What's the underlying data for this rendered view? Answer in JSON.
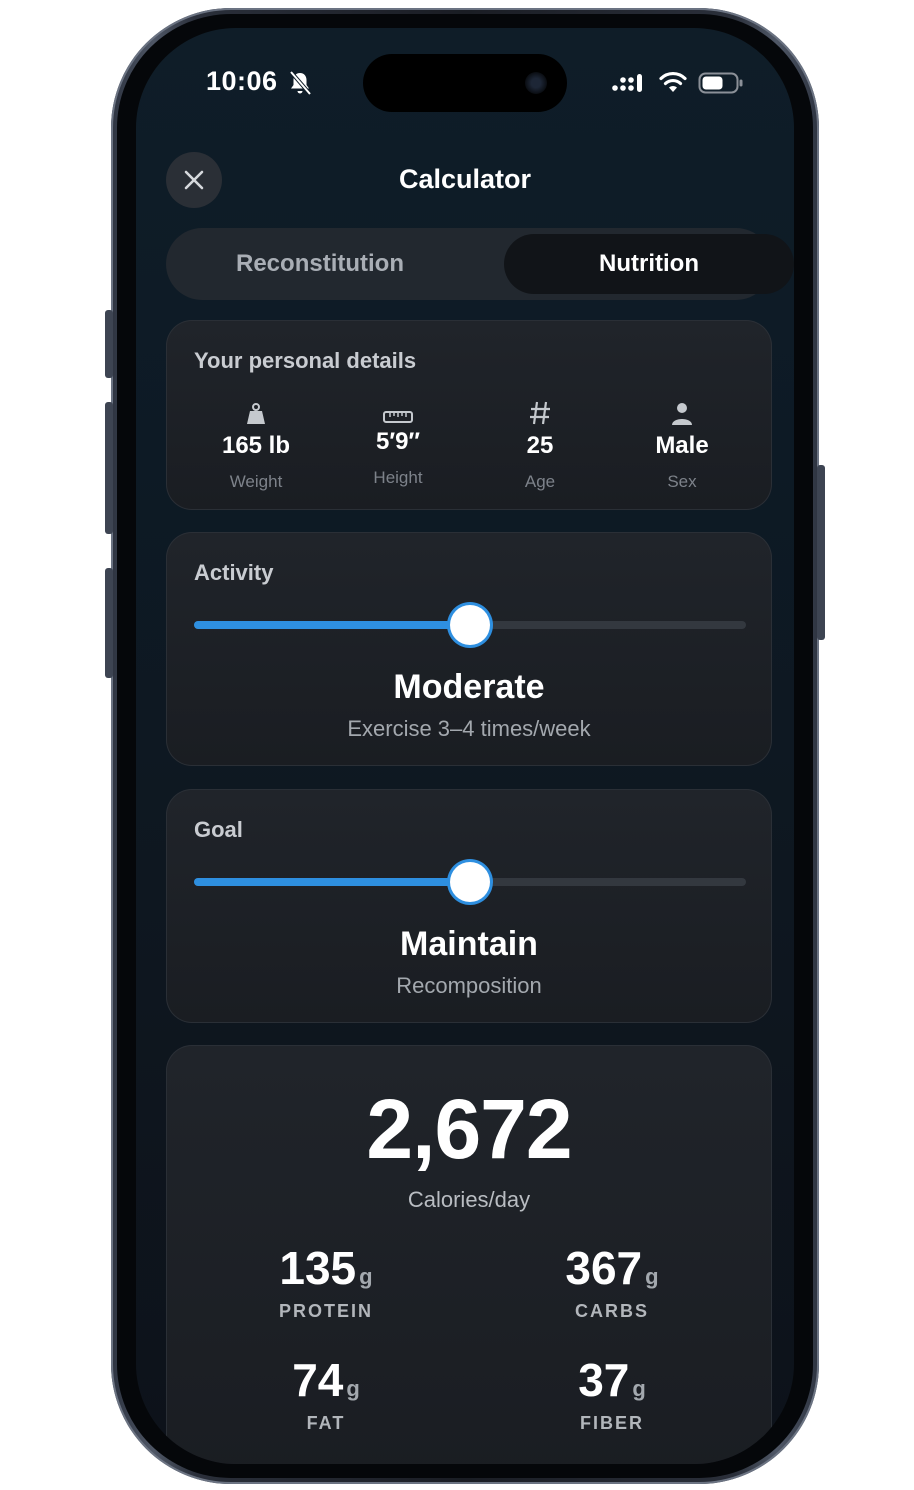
{
  "status_bar": {
    "time": "10:06"
  },
  "header": {
    "title": "Calculator"
  },
  "tabs": [
    {
      "label": "Reconstitution",
      "selected": false
    },
    {
      "label": "Nutrition",
      "selected": true
    }
  ],
  "personal": {
    "heading": "Your personal details",
    "items": [
      {
        "icon": "weight-icon",
        "value": "165 lb",
        "label": "Weight"
      },
      {
        "icon": "ruler-icon",
        "value": "5′9″",
        "label": "Height"
      },
      {
        "icon": "hash-icon",
        "value": "25",
        "label": "Age"
      },
      {
        "icon": "person-icon",
        "value": "Male",
        "label": "Sex"
      }
    ]
  },
  "activity": {
    "heading": "Activity",
    "level": 0.5,
    "value": "Moderate",
    "description": "Exercise 3–4 times/week"
  },
  "goal": {
    "heading": "Goal",
    "level": 0.5,
    "value": "Maintain",
    "description": "Recomposition"
  },
  "results": {
    "calories": "2,672",
    "calories_label": "Calories/day",
    "macros": [
      {
        "value": "135",
        "unit": "g",
        "label": "PROTEIN"
      },
      {
        "value": "367",
        "unit": "g",
        "label": "CARBS"
      },
      {
        "value": "74",
        "unit": "g",
        "label": "FAT"
      },
      {
        "value": "37",
        "unit": "g",
        "label": "FIBER"
      }
    ]
  },
  "colors": {
    "accent": "#2e8fe0",
    "background": "#0e1a24",
    "card": "#1d2026"
  }
}
